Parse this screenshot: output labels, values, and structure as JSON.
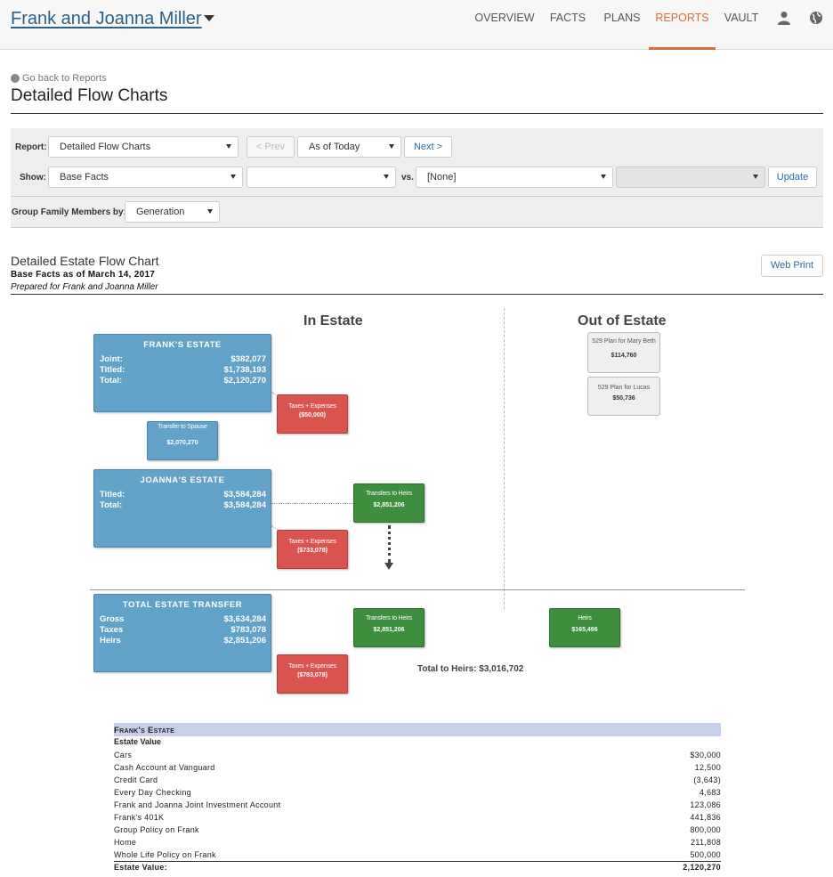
{
  "header": {
    "client_name": "Frank and Joanna Miller",
    "nav": [
      {
        "label": "OVERVIEW",
        "active": false
      },
      {
        "label": "FACTS",
        "active": false
      },
      {
        "label": "PLANS",
        "active": false
      },
      {
        "label": "REPORTS",
        "active": true
      },
      {
        "label": "VAULT",
        "active": false
      }
    ],
    "icons": [
      "user-icon",
      "globe-icon"
    ],
    "accent_color": "#e06b3f"
  },
  "page": {
    "back_link": "Go back to Reports",
    "title": "Detailed Flow Charts"
  },
  "controls": {
    "report_label": "Report:",
    "report_value": "Detailed Flow Charts",
    "prev_label": "< Prev",
    "as_of_value": "As of Today",
    "next_label": "Next >",
    "show_label": "Show:",
    "show_value": "Base Facts",
    "show_secondary_value": "",
    "vs_label": "vs.",
    "vs_value": "[None]",
    "vs_secondary_value": "",
    "update_label": "Update",
    "group_label": "Group Family Members by:",
    "group_value": "Generation"
  },
  "report": {
    "title": "Detailed Estate Flow Chart",
    "subtitle": "Base Facts as of March 14, 2017",
    "prepared_for": "Prepared for Frank and Joanna Miller",
    "web_print_label": "Web Print"
  },
  "flow": {
    "in_estate_heading": "In Estate",
    "out_estate_heading": "Out of Estate",
    "franks_estate": {
      "title": "FRANK'S ESTATE",
      "rows": [
        {
          "label": "Joint:",
          "value": "$382,077"
        },
        {
          "label": "Titled:",
          "value": "$1,738,193"
        },
        {
          "label": "Total:",
          "value": "$2,120,270"
        }
      ]
    },
    "frank_taxes": {
      "label": "Taxes + Expenses",
      "value": "($50,000)"
    },
    "transfer_to_spouse": {
      "label": "Transfer to Spouse",
      "value": "$2,070,270"
    },
    "joannas_estate": {
      "title": "JOANNA'S ESTATE",
      "rows": [
        {
          "label": "Titled:",
          "value": "$3,584,284"
        },
        {
          "label": "Total:",
          "value": "$3,584,284"
        }
      ]
    },
    "joanna_transfers": {
      "label": "Transfers to Heirs",
      "value": "$2,851,206"
    },
    "joanna_taxes": {
      "label": "Taxes + Expenses",
      "value": "($733,078)"
    },
    "total_estate_transfer": {
      "title": "TOTAL ESTATE TRANSFER",
      "rows": [
        {
          "label": "Gross",
          "value": "$3,634,284"
        },
        {
          "label": "Taxes",
          "value": "$783,078"
        },
        {
          "label": "Heirs",
          "value": "$2,851,206"
        }
      ]
    },
    "total_transfers": {
      "label": "Transfers to Heirs",
      "value": "$2,851,206"
    },
    "total_taxes": {
      "label": "Taxes + Expenses",
      "value": "($783,078)"
    },
    "out_heirs": {
      "label": "Heirs",
      "value": "$165,496"
    },
    "plan_mary_beth": {
      "label": "529 Plan for Mary Beth",
      "value": "$114,760"
    },
    "plan_lucas": {
      "label": "529 Plan for Lucas",
      "value": "$50,736"
    },
    "total_to_heirs": "Total to Heirs: $3,016,702"
  },
  "table": {
    "heading": "Frank's Estate",
    "subheading": "Estate Value",
    "rows": [
      {
        "name": "Cars",
        "amount": "$30,000"
      },
      {
        "name": "Cash Account at Vanguard",
        "amount": "12,500"
      },
      {
        "name": "Credit Card",
        "amount": "(3,643)"
      },
      {
        "name": "Every Day Checking",
        "amount": "4,683"
      },
      {
        "name": "Frank and Joanna Joint Investment Account",
        "amount": "123,086"
      },
      {
        "name": "Frank's 401K",
        "amount": "441,836"
      },
      {
        "name": "Group Policy on Frank",
        "amount": "800,000"
      },
      {
        "name": "Home",
        "amount": "211,808"
      },
      {
        "name": "Whole Life Policy on Frank",
        "amount": "500,000"
      }
    ],
    "total_label": "Estate Value:",
    "total_amount": "2,120,270"
  }
}
